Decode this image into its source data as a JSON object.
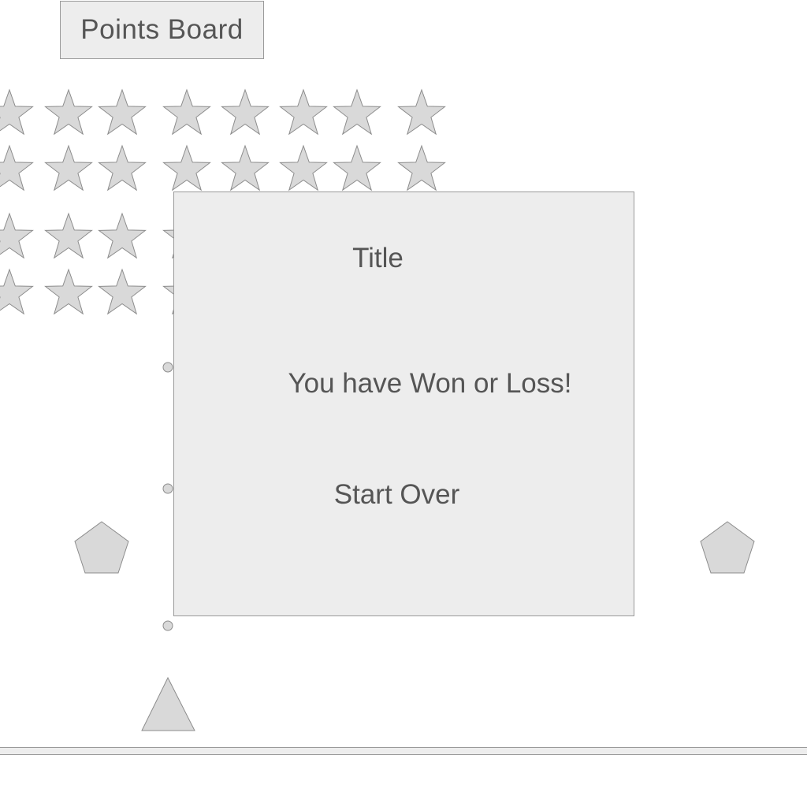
{
  "header": {
    "points_board_label": "Points Board"
  },
  "modal": {
    "title": "Title",
    "message": "You have Won or Loss!",
    "button_label": "Start Over"
  },
  "game": {
    "star_rows": 4,
    "stars_per_row": 8,
    "icons": {
      "brick": "star-icon",
      "ball": "circle-icon",
      "bumper": "pentagon-icon",
      "paddle": "triangle-icon"
    }
  },
  "colors": {
    "shape_fill": "#d9d9d9",
    "shape_stroke": "#8c8c8c",
    "panel_fill": "#ededed",
    "panel_border": "#999999",
    "text": "#555555"
  }
}
